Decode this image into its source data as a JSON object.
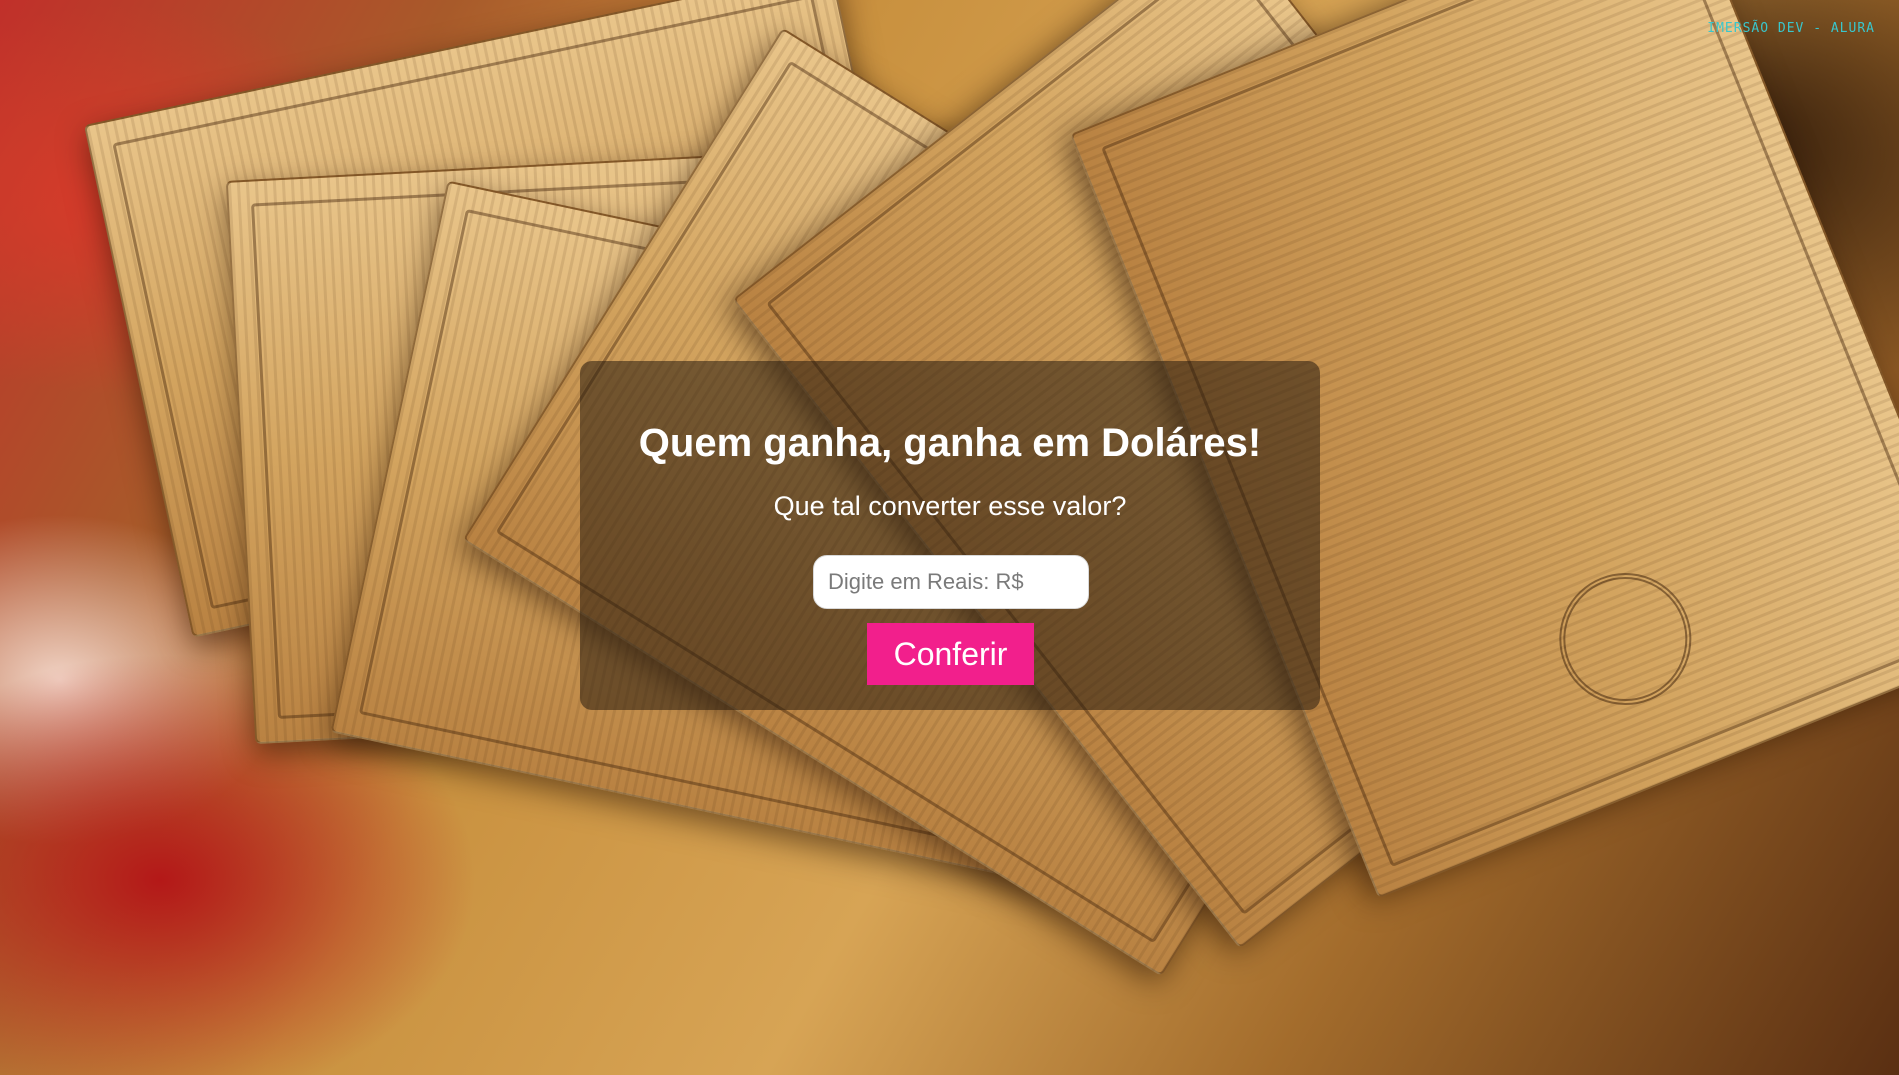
{
  "header": {
    "brand": "IMERSÃO DEV - ALURA"
  },
  "card": {
    "title": "Quem ganha, ganha em Doláres!",
    "subtitle": "Que tal converter esse valor?",
    "input": {
      "value": "",
      "placeholder": "Digite em Reais: R$"
    },
    "button_label": "Conferir"
  },
  "colors": {
    "accent_button": "#f21f8c",
    "brand_text": "#39c6cc",
    "card_overlay": "rgba(40,28,14,0.55)"
  }
}
